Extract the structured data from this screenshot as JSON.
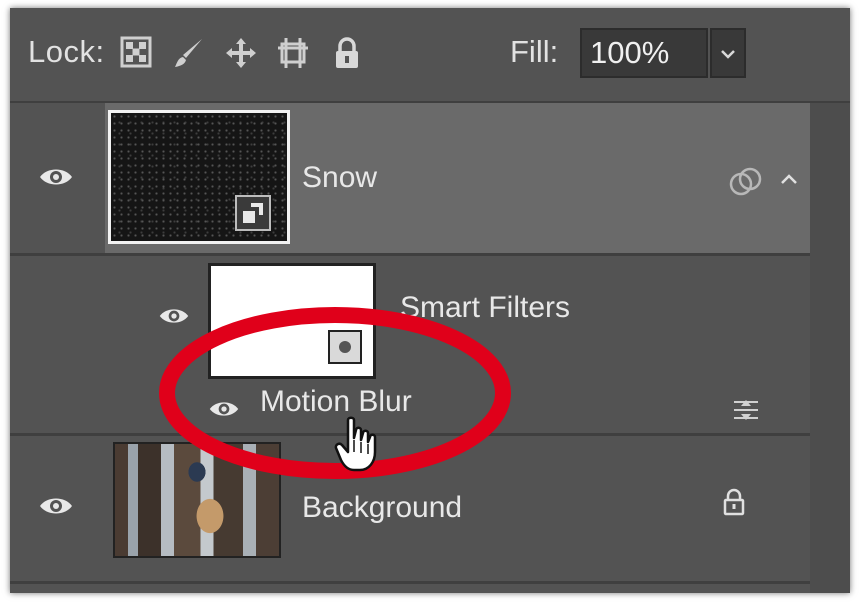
{
  "lock_bar": {
    "lock_label": "Lock:",
    "fill_label": "Fill:",
    "fill_value": "100%"
  },
  "layers": {
    "snow": {
      "name": "Snow"
    },
    "smart_filters": {
      "name": "Smart Filters"
    },
    "motion_blur": {
      "name": "Motion Blur"
    },
    "background": {
      "name": "Background"
    }
  },
  "colors": {
    "panel_bg": "#535353",
    "selected_row": "#6a6a6a",
    "annotation_red": "#e0001a"
  },
  "icons": [
    "lock-transparent-pixels-icon",
    "lock-image-pixels-icon",
    "lock-position-icon",
    "lock-artboard-icon",
    "lock-all-icon",
    "visibility-eye-icon",
    "smart-object-badge-icon",
    "link-circles-icon",
    "collapse-chevron-icon",
    "filter-blending-options-icon",
    "layer-lock-icon",
    "hand-cursor-icon"
  ]
}
